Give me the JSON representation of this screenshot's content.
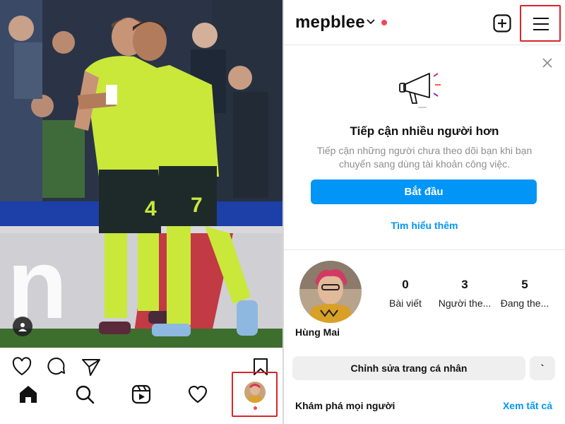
{
  "left_panel": {
    "post_photo": {
      "subject": "football-celebration-photo"
    },
    "actions": {
      "like_icon": "heart-outline-icon",
      "comment_icon": "comment-icon",
      "share_icon": "paper-plane-icon",
      "save_icon": "bookmark-icon"
    },
    "nav": {
      "home_icon": "home-icon",
      "search_icon": "search-icon",
      "reels_icon": "reels-icon",
      "activity_icon": "heart-icon",
      "profile_icon": "profile-avatar-icon"
    },
    "jersey_numbers": [
      "4",
      "7"
    ]
  },
  "right_panel": {
    "header": {
      "username": "mepblee",
      "dropdown_icon": "chevron-down-icon",
      "new_post_icon": "plus-square-icon",
      "menu_icon": "hamburger-menu-icon"
    },
    "promo": {
      "close_icon": "close-icon",
      "illustration_icon": "megaphone-icon",
      "title": "Tiếp cận nhiều người hơn",
      "description": "Tiếp cận những người chưa theo dõi bạn khi bạn chuyển sang dùng tài khoản công việc.",
      "cta_label": "Bắt đầu",
      "learn_more": "Tìm hiểu thêm"
    },
    "profile": {
      "name": "Hùng Mai",
      "stats": [
        {
          "value": "0",
          "label": "Bài viết"
        },
        {
          "value": "3",
          "label": "Người the..."
        },
        {
          "value": "5",
          "label": "Đang the..."
        }
      ],
      "edit_label": "Chỉnh sửa trang cá nhân",
      "more_label": "`",
      "discover_label": "Khám phá mọi người",
      "see_all_label": "Xem tất cả"
    }
  },
  "colors": {
    "accent_blue": "#0095f6",
    "highlight_red": "#d9262b",
    "notification_red": "#ed4956",
    "secondary_text": "#8e8e8e",
    "button_gray": "#efefef"
  }
}
